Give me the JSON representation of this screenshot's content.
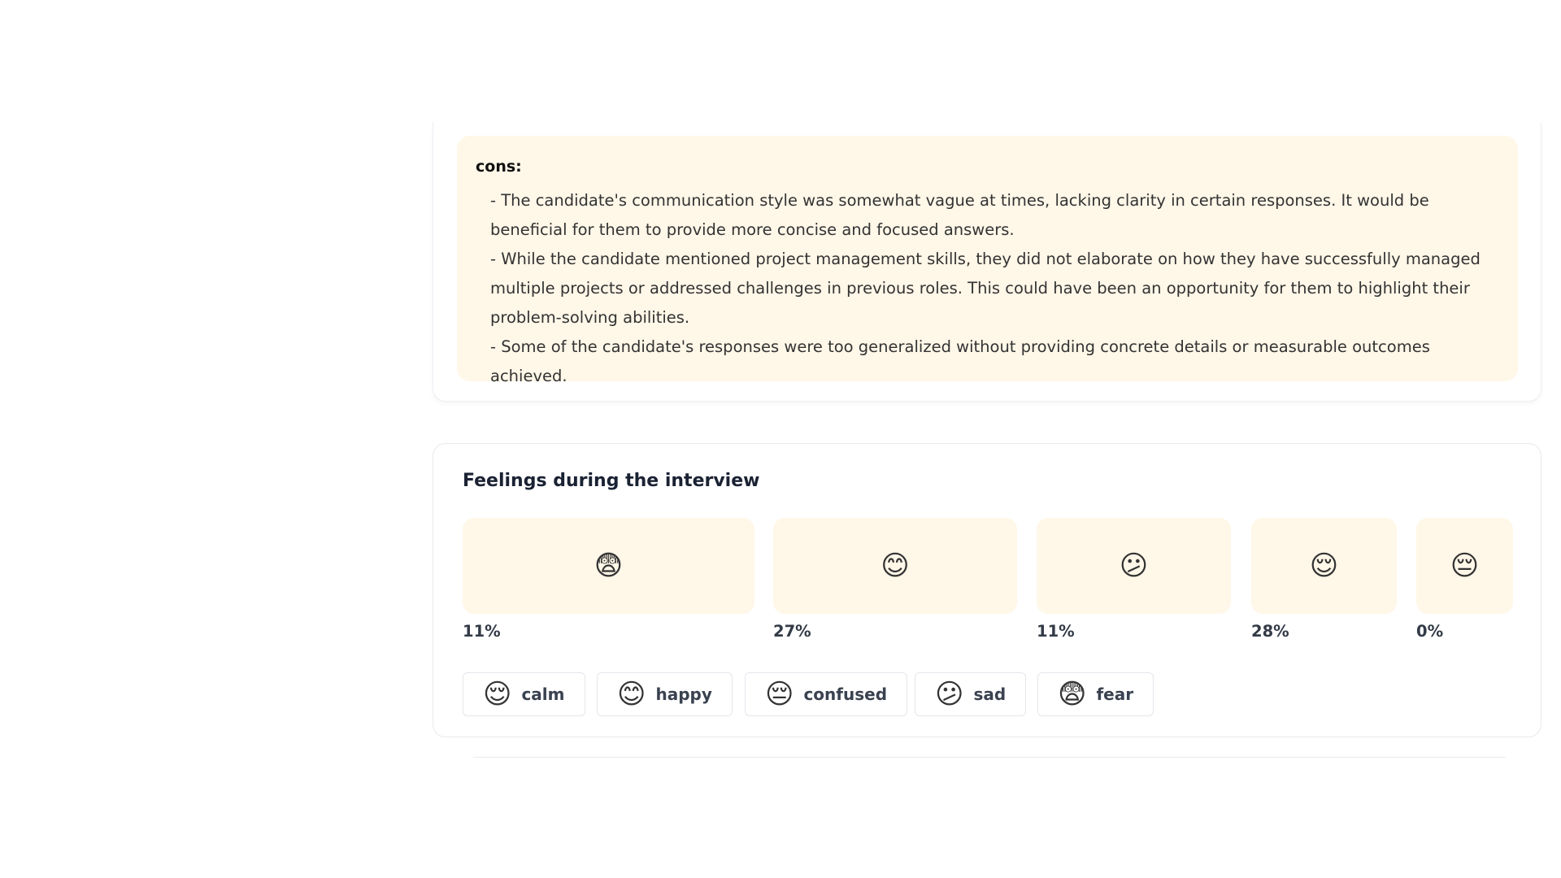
{
  "cons": {
    "heading": "cons:",
    "items": [
      "- The candidate's communication style was somewhat vague at times, lacking clarity in certain responses. It would be beneficial for them to provide more concise and focused answers.",
      "- While the candidate mentioned project management skills, they did not elaborate on how they have successfully managed multiple projects or addressed challenges in previous roles. This could have been an opportunity for them to highlight their problem-solving abilities.",
      "- Some of the candidate's responses were too generalized without providing concrete details or measurable outcomes achieved."
    ]
  },
  "feelings": {
    "title": "Feelings during the interview",
    "bars": [
      {
        "emoji": "😨",
        "icon": "fearful-face-icon",
        "percent": "11%"
      },
      {
        "emoji": "😊",
        "icon": "smiling-face-icon",
        "percent": "27%"
      },
      {
        "emoji": "😕",
        "icon": "confused-face-icon",
        "percent": "11%"
      },
      {
        "emoji": "😌",
        "icon": "relieved-face-icon",
        "percent": "28%"
      },
      {
        "emoji": "😔",
        "icon": "pensive-face-icon",
        "percent": "0%"
      }
    ],
    "legend": [
      {
        "emoji": "😌",
        "icon": "relieved-face-icon",
        "label": "calm"
      },
      {
        "emoji": "😊",
        "icon": "smiling-face-icon",
        "label": "happy"
      },
      {
        "emoji": "😔",
        "icon": "pensive-face-icon",
        "label": "confused"
      },
      {
        "emoji": "😕",
        "icon": "confused-face-icon",
        "label": "sad"
      },
      {
        "emoji": "😨",
        "icon": "fearful-face-icon",
        "label": "fear"
      }
    ]
  },
  "colors": {
    "card_tint": "#fff7e8",
    "border": "#e7eaee",
    "heading": "#1a2233"
  }
}
